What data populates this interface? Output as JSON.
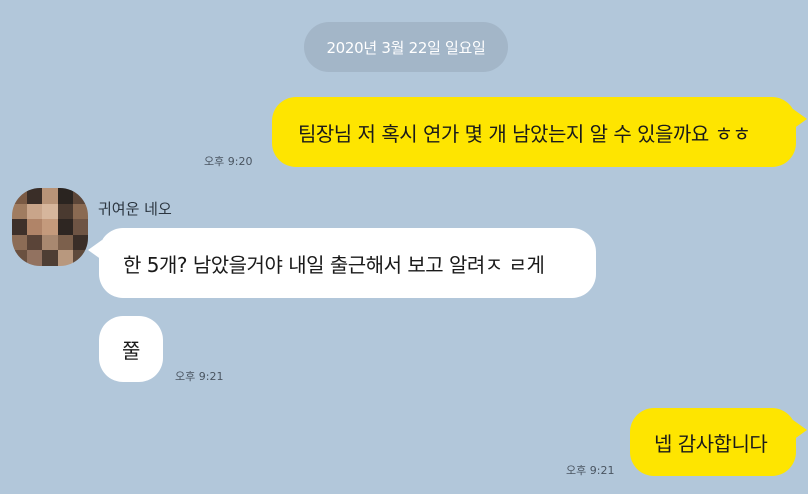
{
  "chat": {
    "date": "2020년 3월 22일 일요일",
    "messages": [
      {
        "direction": "out",
        "text": "팀장님 저 혹시 연가 몇 개 남았는지 알 수 있을까요 ㅎㅎ",
        "time": "오후 9:20"
      },
      {
        "direction": "in",
        "sender": "귀여운 네오",
        "text": "한 5개? 남았을거야 내일 출근해서 보고 알려ㅈ ㄹ게"
      },
      {
        "direction": "in",
        "text": "쭐",
        "time": "오후 9:21"
      },
      {
        "direction": "out",
        "text": "넵 감사합니다",
        "time": "오후 9:21"
      }
    ]
  },
  "avatar": {
    "description_icon": "pixelated-profile-photo",
    "pixels": [
      "#7a5a44",
      "#3a2e28",
      "#b89478",
      "#2a2420",
      "#5c4638",
      "#a07c60",
      "#c9a58a",
      "#d6b69c",
      "#4a3a30",
      "#8a6a52",
      "#3e302a",
      "#b08468",
      "#c49a7c",
      "#2e2622",
      "#6e5444",
      "#8c6c56",
      "#5a4438",
      "#a88870",
      "#7c604c",
      "#3a2e28",
      "#6a5040",
      "#927260",
      "#4e3e34",
      "#b8987e",
      "#5e4a3c"
    ]
  },
  "colors": {
    "background": "#b2c7da",
    "outgoing_bubble": "#fee500",
    "incoming_bubble": "#ffffff"
  }
}
